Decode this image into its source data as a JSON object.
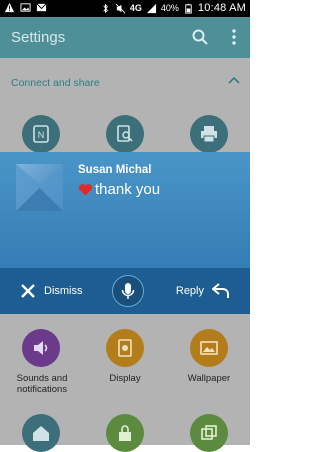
{
  "status": {
    "time": "10:48 AM",
    "battery": "40%",
    "network": "4G"
  },
  "appbar": {
    "title": "Settings"
  },
  "section": {
    "title": "Connect and share"
  },
  "notification": {
    "name": "Susan Michal",
    "message": "thank you",
    "dismiss_label": "Dismiss",
    "reply_label": "Reply"
  },
  "tiles": [
    {
      "label": "Sounds and\nnotifications",
      "icon": "speaker-icon",
      "color": "#6b3a8b"
    },
    {
      "label": "Display",
      "icon": "display-icon",
      "color": "#b37d1b"
    },
    {
      "label": "Wallpaper",
      "icon": "wallpaper-icon",
      "color": "#b37d1b"
    }
  ]
}
